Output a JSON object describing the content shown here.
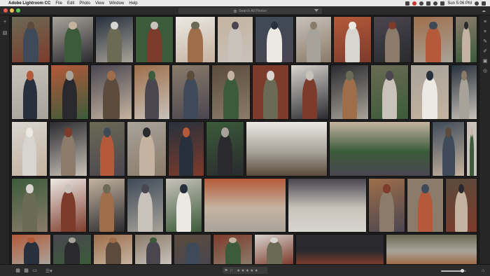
{
  "menubar": {
    "app_name": "Adobe Lightroom CC",
    "menus": [
      "File",
      "Edit",
      "Photo",
      "View",
      "Window",
      "Help"
    ],
    "clock": "Sun 5:06 PM"
  },
  "toolbar": {
    "search_placeholder": "Search All Photos"
  },
  "left_panel": {
    "icons": [
      "add-photos-icon",
      "library-icon"
    ]
  },
  "right_panel": {
    "icons": [
      "edit-sliders-icon",
      "crop-icon",
      "healing-icon",
      "brush-icon",
      "gradient-icon",
      "radial-icon"
    ]
  },
  "grid": {
    "photo_count": 67,
    "rows_visible": 6,
    "palette": [
      "#6b6a55",
      "#8a7b6a",
      "#3e4a58",
      "#a8a39a",
      "#5a4b3c",
      "#c8c2ba",
      "#27303c",
      "#7d3b2c",
      "#b45a3a",
      "#3b5b3a",
      "#d8d5d0",
      "#4a4650",
      "#ece9e4",
      "#2a2a2e",
      "#9e6e4a",
      "#c4b3a0"
    ]
  },
  "bottom_bar": {
    "view_modes": [
      "grid-view-icon",
      "square-grid-icon",
      "detail-view-icon"
    ],
    "sort_icon": "sort-icon",
    "rating_stars": "★★★★★",
    "flag_icon": "flag-icon",
    "thumbnail_size": 0.85,
    "tag_icon": "tag-icon"
  }
}
